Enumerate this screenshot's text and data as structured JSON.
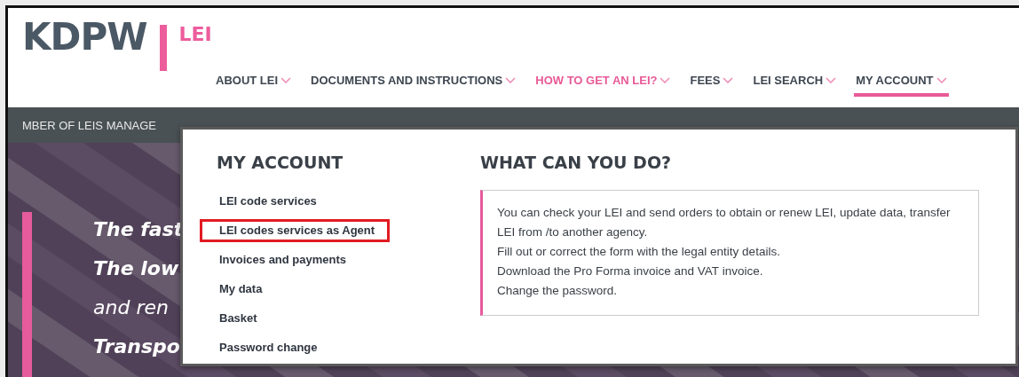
{
  "logo": {
    "name": "KDPW",
    "suffix": "LEI"
  },
  "nav": [
    {
      "label": "ABOUT LEI",
      "selected": false,
      "highlighted": false
    },
    {
      "label": "DOCUMENTS AND INSTRUCTIONS",
      "selected": false,
      "highlighted": false
    },
    {
      "label": "HOW TO GET AN LEI?",
      "selected": false,
      "highlighted": true
    },
    {
      "label": "FEES",
      "selected": false,
      "highlighted": false
    },
    {
      "label": "LEI SEARCH",
      "selected": false,
      "highlighted": false
    },
    {
      "label": "MY ACCOUNT",
      "selected": true,
      "highlighted": false
    }
  ],
  "info_bar": {
    "text": "MBER OF LEIS MANAGE"
  },
  "hero": {
    "kind": "picture",
    "lines": [
      {
        "text": "The fast",
        "bold": true
      },
      {
        "text": "The low",
        "bold": true
      },
      {
        "text": "and ren",
        "bold": false
      },
      {
        "text": "Transpo",
        "bold": true
      }
    ]
  },
  "dropdown": {
    "title": "MY ACCOUNT",
    "items": [
      {
        "label": "LEI code services",
        "outlined": false
      },
      {
        "label": "LEI codes services as Agent",
        "outlined": true
      },
      {
        "label": "Invoices and payments",
        "outlined": false
      },
      {
        "label": "My data",
        "outlined": false
      },
      {
        "label": "Basket",
        "outlined": false
      },
      {
        "label": "Password change",
        "outlined": false
      }
    ],
    "info_title": "WHAT CAN YOU DO?",
    "info_lines": [
      "You can check your LEI and send orders to obtain or renew LEI, update data, transfer LEI from /to another agency.",
      "Fill out or correct the form with the legal entity details.",
      "Download the Pro Forma invoice and VAT invoice.",
      "Change the password."
    ]
  }
}
